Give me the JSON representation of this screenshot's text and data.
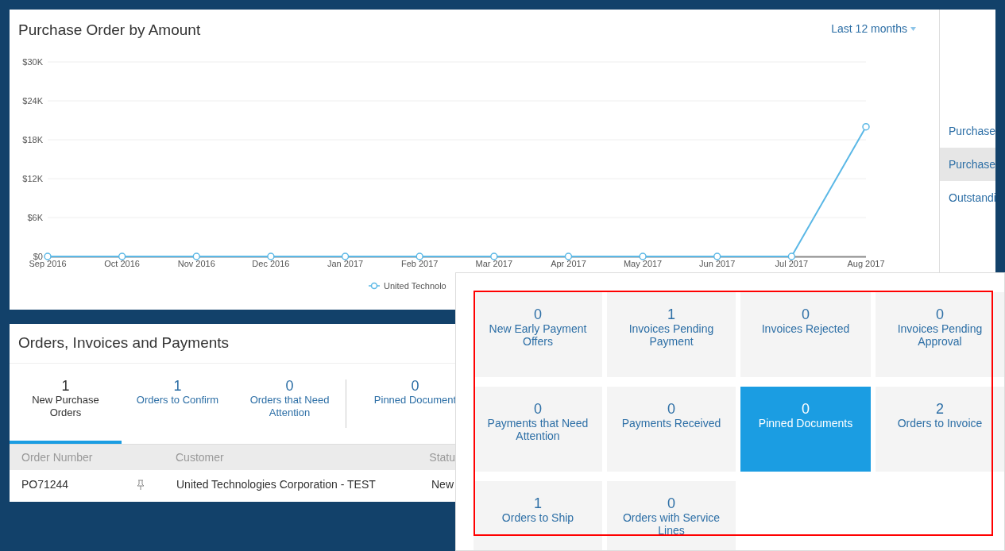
{
  "chart_card": {
    "title": "Purchase Order by Amount",
    "range_dropdown": "Last 12 months",
    "chart_data": {
      "type": "line",
      "grid": true,
      "categories": [
        "Sep 2016",
        "Oct 2016",
        "Nov 2016",
        "Dec 2016",
        "Jan 2017",
        "Feb 2017",
        "Mar 2017",
        "Apr 2017",
        "May 2017",
        "Jun 2017",
        "Jul 2017",
        "Aug 2017"
      ],
      "series": [
        {
          "name": "United Technolo",
          "color": "#5bb8e6",
          "marker": true,
          "values": [
            0,
            0,
            0,
            0,
            0,
            0,
            0,
            0,
            0,
            0,
            0,
            20000
          ]
        }
      ],
      "ylim": [
        0,
        30000
      ],
      "yticks": [
        {
          "value": 0,
          "label": "$0"
        },
        {
          "value": 6000,
          "label": "$6K"
        },
        {
          "value": 12000,
          "label": "$12K"
        },
        {
          "value": 18000,
          "label": "$18K"
        },
        {
          "value": 24000,
          "label": "$24K"
        },
        {
          "value": 30000,
          "label": "$30K"
        }
      ]
    }
  },
  "side_menu": [
    {
      "label": "Purchase",
      "selected": false
    },
    {
      "label": "Purchase",
      "selected": true
    },
    {
      "label": "Outstandi",
      "selected": false
    }
  ],
  "orders_card": {
    "title": "Orders, Invoices and Payments",
    "tabs": [
      {
        "count": "1",
        "label": "New Purchase Orders",
        "selected": true
      },
      {
        "count": "1",
        "label": "Orders to Confirm",
        "selected": false
      },
      {
        "count": "0",
        "label": "Orders that Need Attention",
        "selected": false
      },
      {
        "count": "0",
        "label": "Pinned Document",
        "selected": false
      }
    ],
    "columns": [
      "Order Number",
      "",
      "Customer",
      "Statu"
    ],
    "rows": [
      {
        "order_number": "PO71244",
        "pinned": true,
        "customer": "United Technologies Corporation - TEST",
        "status": "New"
      }
    ]
  },
  "tiles_popover": {
    "tiles": [
      {
        "count": "0",
        "label": "New Early Payment Offers",
        "selected": false
      },
      {
        "count": "1",
        "label": "Invoices Pending Payment",
        "selected": false
      },
      {
        "count": "0",
        "label": "Invoices Rejected",
        "selected": false
      },
      {
        "count": "0",
        "label": "Invoices Pending Approval",
        "selected": false
      },
      {
        "count": "0",
        "label": "Payments that Need Attention",
        "selected": false
      },
      {
        "count": "0",
        "label": "Payments Received",
        "selected": false
      },
      {
        "count": "0",
        "label": "Pinned Documents",
        "selected": true
      },
      {
        "count": "2",
        "label": "Orders to Invoice",
        "selected": false
      },
      {
        "count": "1",
        "label": "Orders to Ship",
        "selected": false
      },
      {
        "count": "0",
        "label": "Orders with Service Lines",
        "selected": false
      }
    ]
  }
}
